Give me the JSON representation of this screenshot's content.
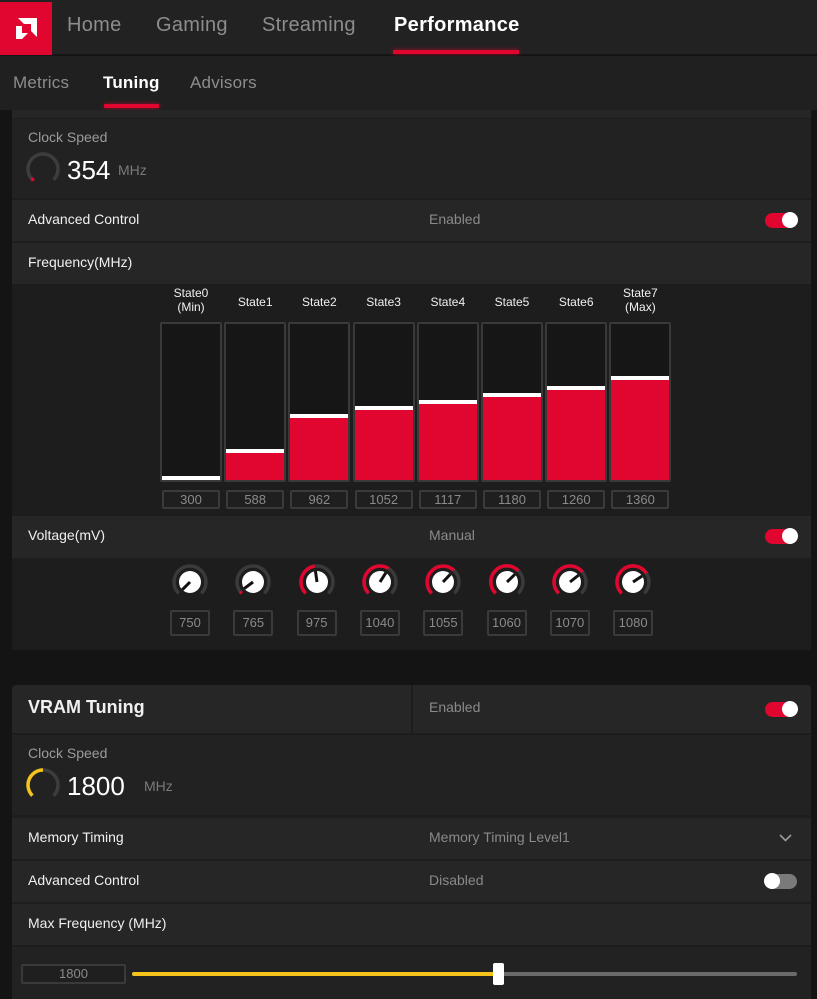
{
  "colors": {
    "accent": "#e0062f",
    "vram_accent": "#f6c31a",
    "panel": "#262626",
    "background": "#141414"
  },
  "nav": {
    "logo": "amd-logo-icon",
    "tabs": [
      {
        "label": "Home",
        "active": false
      },
      {
        "label": "Gaming",
        "active": false
      },
      {
        "label": "Streaming",
        "active": false
      },
      {
        "label": "Performance",
        "active": true
      }
    ]
  },
  "subnav": {
    "tabs": [
      {
        "label": "Metrics",
        "active": false
      },
      {
        "label": "Tuning",
        "active": true
      },
      {
        "label": "Advisors",
        "active": false
      }
    ]
  },
  "gpu_tuning": {
    "clock_speed": {
      "label": "Clock Speed",
      "value": "354",
      "unit": "MHz",
      "gauge_fraction": 0.02
    },
    "advanced_control": {
      "label": "Advanced Control",
      "value": "Enabled",
      "toggle": true
    },
    "frequency": {
      "label": "Frequency(MHz)",
      "fill_scale_max_mhz": 1650,
      "states": [
        {
          "name": "State0",
          "sub": "(Min)",
          "value": "300",
          "fill": 0.0
        },
        {
          "name": "State1",
          "sub": "",
          "value": "588",
          "fill": 0.17
        },
        {
          "name": "State2",
          "sub": "",
          "value": "962",
          "fill": 0.4
        },
        {
          "name": "State3",
          "sub": "",
          "value": "1052",
          "fill": 0.45
        },
        {
          "name": "State4",
          "sub": "",
          "value": "1117",
          "fill": 0.49
        },
        {
          "name": "State5",
          "sub": "",
          "value": "1180",
          "fill": 0.53
        },
        {
          "name": "State6",
          "sub": "",
          "value": "1260",
          "fill": 0.58
        },
        {
          "name": "State7",
          "sub": "(Max)",
          "value": "1360",
          "fill": 0.64
        }
      ]
    },
    "voltage": {
      "label": "Voltage(mV)",
      "mode": "Manual",
      "toggle": true,
      "knobs": [
        {
          "value": "750",
          "fraction": 0.0
        },
        {
          "value": "765",
          "fraction": 0.03
        },
        {
          "value": "975",
          "fraction": 0.47
        },
        {
          "value": "1040",
          "fraction": 0.62
        },
        {
          "value": "1055",
          "fraction": 0.66
        },
        {
          "value": "1060",
          "fraction": 0.67
        },
        {
          "value": "1070",
          "fraction": 0.69
        },
        {
          "value": "1080",
          "fraction": 0.71
        }
      ]
    }
  },
  "vram_tuning": {
    "title": "VRAM Tuning",
    "status": "Enabled",
    "toggle": true,
    "clock_speed": {
      "label": "Clock Speed",
      "value": "1800",
      "unit": "MHz",
      "gauge_fraction": 0.45
    },
    "memory_timing": {
      "label": "Memory Timing",
      "value": "Memory Timing Level1"
    },
    "advanced_control": {
      "label": "Advanced Control",
      "value": "Disabled",
      "toggle": false
    },
    "max_frequency": {
      "label": "Max Frequency (MHz)",
      "value": "1800",
      "slider_fraction": 0.55
    }
  }
}
